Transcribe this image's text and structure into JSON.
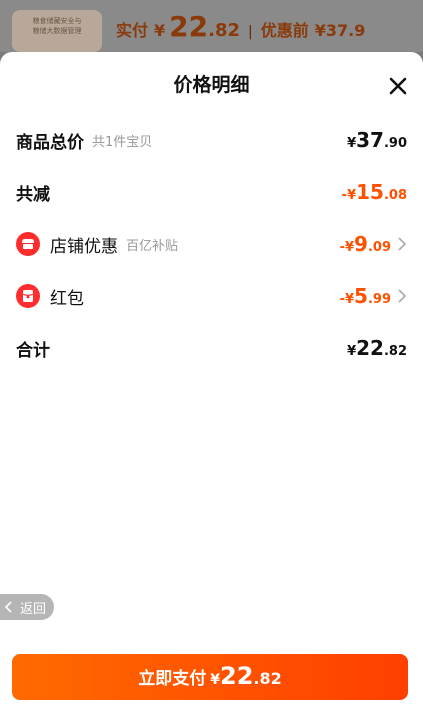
{
  "background": {
    "thumb_text": "粮食储藏安全与\n粮储大数据管理",
    "paid_label": "实付",
    "paid_currency": "¥",
    "paid_int": "22",
    "paid_dec": ".82",
    "separator": "|",
    "before_label": "优惠前",
    "before_price": "¥37.9"
  },
  "sheet": {
    "title": "价格明细",
    "rows": [
      {
        "label": "商品总价",
        "sub": "共1件宝贝",
        "currency": "¥",
        "int": "37",
        "dec": ".90"
      },
      {
        "label": "共减",
        "sub": "",
        "currency": "-¥",
        "int": "15",
        "dec": ".08"
      },
      {
        "label": "店铺优惠",
        "sub": "百亿补贴",
        "currency": "-¥",
        "int": "9",
        "dec": ".09"
      },
      {
        "label": "红包",
        "sub": "",
        "currency": "-¥",
        "int": "5",
        "dec": ".99"
      },
      {
        "label": "合计",
        "sub": "",
        "currency": "¥",
        "int": "22",
        "dec": ".82"
      }
    ]
  },
  "back_label": "返回",
  "pay": {
    "label": "立即支付",
    "currency": "¥",
    "int": "22",
    "dec": ".82"
  },
  "colors": {
    "accent": "#ff5000",
    "icon_red": "#ff2d2d"
  }
}
